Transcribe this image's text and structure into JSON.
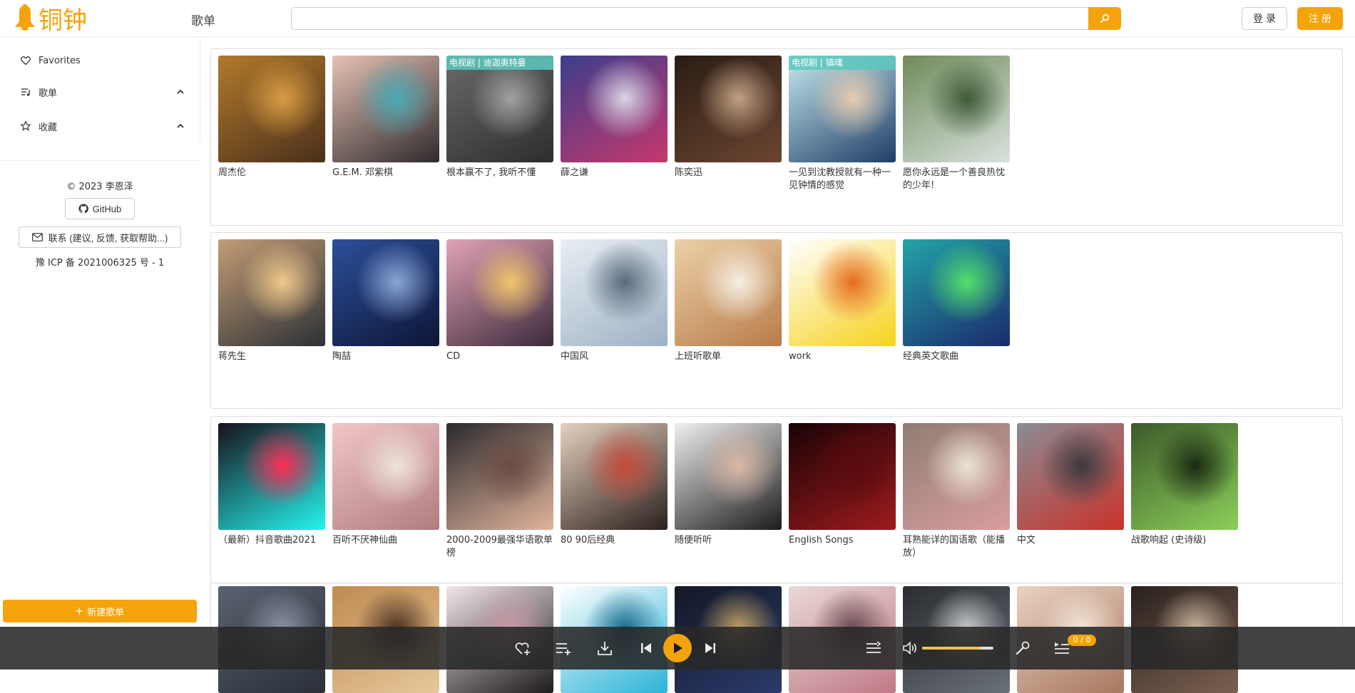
{
  "header": {
    "logo_text": "铜钟",
    "nav_title": "歌单",
    "search_value": "",
    "login_label": "登 录",
    "register_label": "注 册"
  },
  "sidebar": {
    "items": [
      {
        "label": "Favorites",
        "icon": "heart-icon"
      },
      {
        "label": "歌单",
        "icon": "playlist-icon",
        "expandable": true
      },
      {
        "label": "收藏",
        "icon": "star-icon",
        "expandable": true
      }
    ],
    "copyright": "© 2023 李恩泽",
    "github_label": "GitHub",
    "contact_label": "联系 (建议, 反馈, 获取帮助...)",
    "icp": "豫 ICP 备 2021006325 号 - 1",
    "new_playlist_label": "新建歌单"
  },
  "sections": [
    {
      "cards": [
        {
          "title": "周杰伦",
          "tag": "",
          "colors": [
            "#b27b2c",
            "#4a2f1a",
            "#d99c44"
          ]
        },
        {
          "title": "G.E.M. 邓紫棋",
          "tag": "",
          "colors": [
            "#e6c2b4",
            "#2f2a2d",
            "#49a9b6"
          ]
        },
        {
          "title": "根本赢不了, 我听不懂",
          "tag": "电视剧 | 迪迦奥特曼",
          "colors": [
            "#6a6a6a",
            "#2d2d2d",
            "#a2a2a2"
          ]
        },
        {
          "title": "薛之谦",
          "tag": "",
          "colors": [
            "#3b3e8c",
            "#c6386c",
            "#d9d4e6"
          ]
        },
        {
          "title": "陈奕迅",
          "tag": "",
          "colors": [
            "#2a1d15",
            "#6b4530",
            "#c1a184"
          ]
        },
        {
          "title": "一见到沈教授就有一种一见钟情的感觉",
          "tag": "电视剧 | 镇魂",
          "colors": [
            "#c7e8ee",
            "#1e3e66",
            "#e8cbb0"
          ]
        },
        {
          "title": "愿你永远是一个善良热忱的少年!",
          "tag": "",
          "colors": [
            "#6f8a5a",
            "#d9e2de",
            "#3f5a36"
          ]
        }
      ]
    },
    {
      "cards": [
        {
          "title": "蒋先生",
          "tag": "",
          "colors": [
            "#c39d75",
            "#2c3035",
            "#f1c98c"
          ]
        },
        {
          "title": "陶喆",
          "tag": "",
          "colors": [
            "#2c4f9a",
            "#0d1636",
            "#8aa7d8"
          ]
        },
        {
          "title": "CD",
          "tag": "",
          "colors": [
            "#e2a3b6",
            "#3b2a3a",
            "#f2c66a"
          ]
        },
        {
          "title": "中国风",
          "tag": "",
          "colors": [
            "#e9eef3",
            "#9db1c4",
            "#5a6b7c"
          ]
        },
        {
          "title": "上班听歌单",
          "tag": "",
          "colors": [
            "#ecd0a8",
            "#b87c4a",
            "#f6efe5"
          ]
        },
        {
          "title": "work",
          "tag": "",
          "colors": [
            "#ffffff",
            "#f6d21a",
            "#e66b1e"
          ]
        },
        {
          "title": "经典英文歌曲",
          "tag": "",
          "colors": [
            "#23a4a8",
            "#1a2a6c",
            "#52e06a"
          ]
        }
      ]
    },
    {
      "cards": [
        {
          "title": "（最新）抖音歌曲2021",
          "tag": "",
          "colors": [
            "#17101a",
            "#25f4ee",
            "#fe2c55"
          ]
        },
        {
          "title": "百听不厌神仙曲",
          "tag": "",
          "colors": [
            "#f1c7c6",
            "#b07c80",
            "#eee4d9"
          ]
        },
        {
          "title": "2000-2009最强华语歌单榜",
          "tag": "",
          "colors": [
            "#2a2a2e",
            "#e1b49b",
            "#6b4b43"
          ]
        },
        {
          "title": "80 90后经典",
          "tag": "",
          "colors": [
            "#e7d1c0",
            "#2b201c",
            "#c44a3a"
          ]
        },
        {
          "title": "随便听听",
          "tag": "",
          "colors": [
            "#f0f0f0",
            "#1d1b1d",
            "#d9b8a5"
          ]
        },
        {
          "title": "English Songs",
          "tag": "",
          "colors": [
            "#1a0305",
            "#9e1b1e",
            "#5a0a0d"
          ]
        },
        {
          "title": "耳熟能详的国语歌（能播放）",
          "tag": "",
          "colors": [
            "#8f7d73",
            "#d99da0",
            "#ece4d6"
          ]
        },
        {
          "title": "中文",
          "tag": "",
          "colors": [
            "#8a8c94",
            "#c8332b",
            "#3a3a40"
          ]
        },
        {
          "title": "战歌响起 (史诗级)",
          "tag": "",
          "colors": [
            "#3c5a2a",
            "#8ccf5a",
            "#1a2a12"
          ]
        }
      ]
    },
    {
      "cards": [
        {
          "title": "",
          "tag": "",
          "colors": [
            "#5a6270",
            "#2a2f38",
            "#8a93a3"
          ]
        },
        {
          "title": "",
          "tag": "",
          "colors": [
            "#c08a52",
            "#e6c89a",
            "#4a3020"
          ]
        },
        {
          "title": "",
          "tag": "",
          "colors": [
            "#f2e6ea",
            "#1d1a1e",
            "#c99aa6"
          ]
        },
        {
          "title": "",
          "tag": "",
          "colors": [
            "#ffffff",
            "#2ab3d6",
            "#1a6a8c"
          ]
        },
        {
          "title": "",
          "tag": "",
          "colors": [
            "#141826",
            "#2a3a6a",
            "#c0a060"
          ]
        },
        {
          "title": "",
          "tag": "",
          "colors": [
            "#e8d8d6",
            "#c07a86",
            "#6a4a50"
          ]
        },
        {
          "title": "",
          "tag": "",
          "colors": [
            "#2a2c30",
            "#6a7078",
            "#c6c8cc"
          ]
        },
        {
          "title": "",
          "tag": "",
          "colors": [
            "#e9d2c2",
            "#a87860",
            "#f3e6d9"
          ]
        },
        {
          "title": "",
          "tag": "",
          "colors": [
            "#2a221e",
            "#7a6050",
            "#c9b29c"
          ]
        }
      ]
    }
  ],
  "player": {
    "queue_count": "0 / 0",
    "volume": 0.82,
    "accent": "#f4a30a"
  }
}
